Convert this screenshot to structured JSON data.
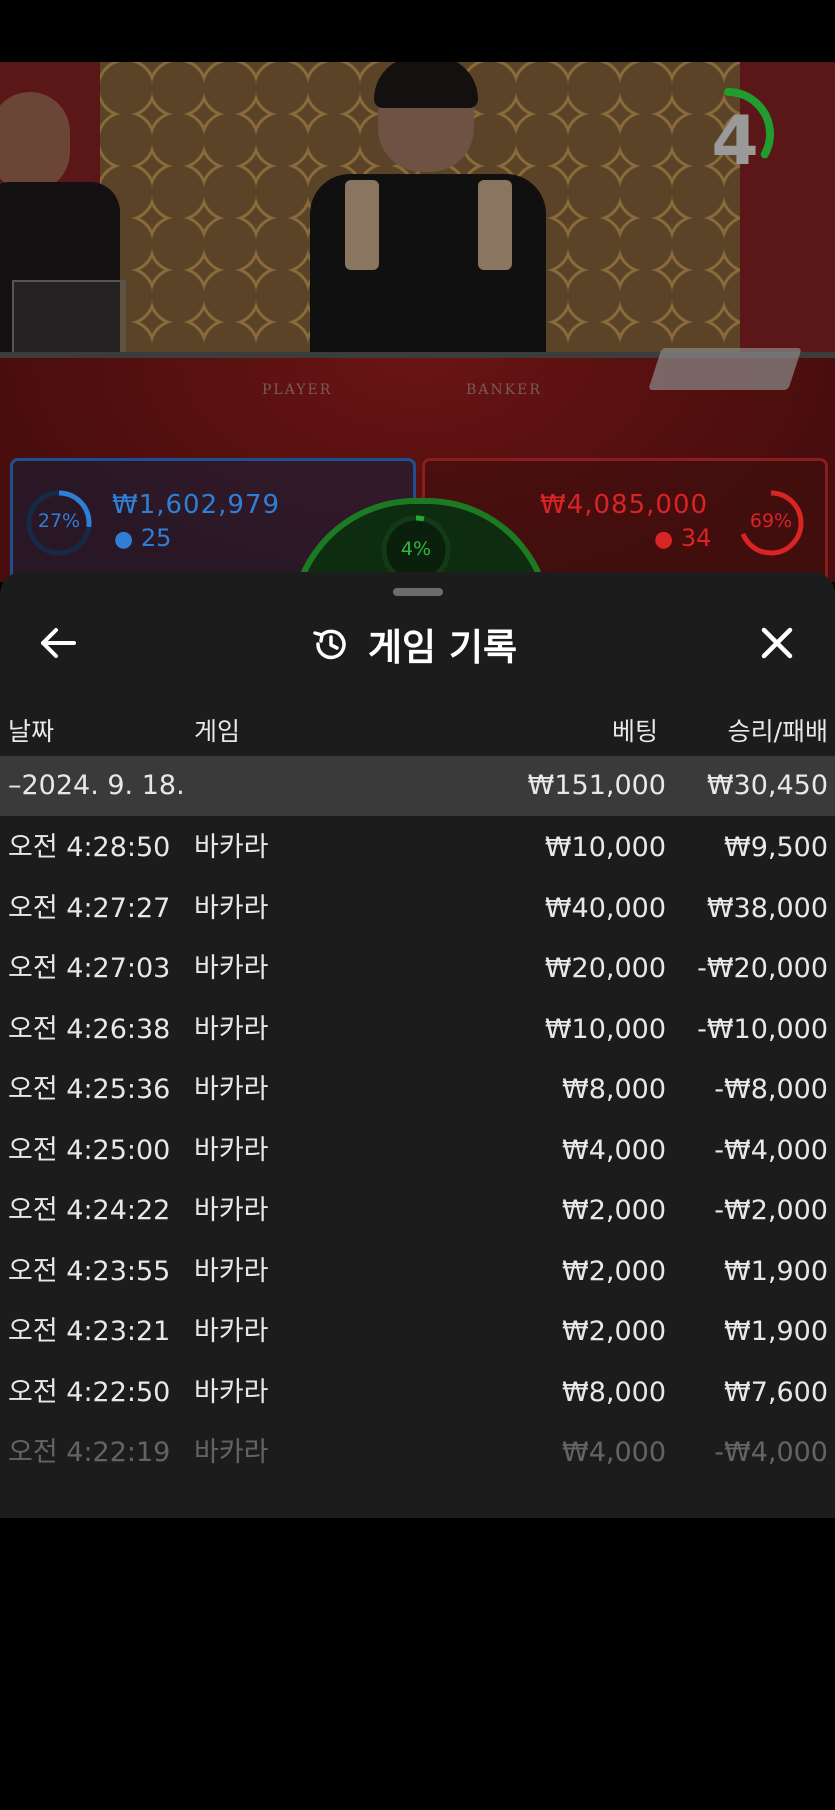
{
  "live": {
    "countdown": "4",
    "player": {
      "percent": "27%",
      "amount": "₩1,602,979",
      "count": "25",
      "percent_value": 0.27
    },
    "banker": {
      "percent": "69%",
      "amount": "₩4,085,000",
      "count": "34",
      "percent_value": 0.69
    },
    "tie": {
      "percent": "4%",
      "percent_value": 0.04
    },
    "table_labels": {
      "player": "PLAYER",
      "banker": "BANKER"
    },
    "colors": {
      "player": "#2e7fd6",
      "banker": "#d92424",
      "tie": "#27a832",
      "timer": "#1f9e2f"
    }
  },
  "sheet": {
    "title": "게임 기록",
    "headers": {
      "date": "날짜",
      "game": "게임",
      "bet": "베팅",
      "result": "승리/패배"
    },
    "summary": {
      "date": "–2024. 9. 18.",
      "bet": "₩151,000",
      "result": "₩30,450"
    },
    "rows": [
      {
        "time": "오전 4:28:50",
        "game": "바카라",
        "bet": "₩10,000",
        "result": "₩9,500"
      },
      {
        "time": "오전 4:27:27",
        "game": "바카라",
        "bet": "₩40,000",
        "result": "₩38,000"
      },
      {
        "time": "오전 4:27:03",
        "game": "바카라",
        "bet": "₩20,000",
        "result": "-₩20,000"
      },
      {
        "time": "오전 4:26:38",
        "game": "바카라",
        "bet": "₩10,000",
        "result": "-₩10,000"
      },
      {
        "time": "오전 4:25:36",
        "game": "바카라",
        "bet": "₩8,000",
        "result": "-₩8,000"
      },
      {
        "time": "오전 4:25:00",
        "game": "바카라",
        "bet": "₩4,000",
        "result": "-₩4,000"
      },
      {
        "time": "오전 4:24:22",
        "game": "바카라",
        "bet": "₩2,000",
        "result": "-₩2,000"
      },
      {
        "time": "오전 4:23:55",
        "game": "바카라",
        "bet": "₩2,000",
        "result": "₩1,900"
      },
      {
        "time": "오전 4:23:21",
        "game": "바카라",
        "bet": "₩2,000",
        "result": "₩1,900"
      },
      {
        "time": "오전 4:22:50",
        "game": "바카라",
        "bet": "₩8,000",
        "result": "₩7,600"
      },
      {
        "time": "오전 4:22:19",
        "game": "바카라",
        "bet": "₩4,000",
        "result": "-₩4,000"
      }
    ],
    "icons": {
      "back": "arrow-left-icon",
      "history": "history-icon",
      "close": "close-icon"
    }
  }
}
